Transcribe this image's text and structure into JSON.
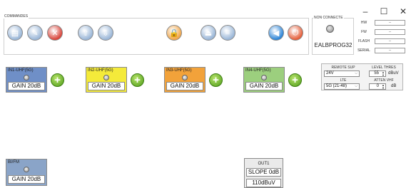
{
  "window": {
    "minimize_glyph": "–",
    "maximize_glyph": "☐",
    "close_glyph": "✕"
  },
  "commandes": {
    "label": "COMMANDES",
    "buttons": [
      {
        "name": "open-file-icon",
        "glyph": "▤",
        "color": "#9bb7d8"
      },
      {
        "name": "edit-icon",
        "glyph": "✎",
        "color": "#9bb7d8"
      },
      {
        "name": "cancel-icon",
        "glyph": "✕",
        "color": "#d9453b"
      },
      {
        "name": "upload-icon",
        "glyph": "⇧",
        "color": "#9bb7d8"
      },
      {
        "name": "download-icon",
        "glyph": "⇩",
        "color": "#9bb7d8"
      },
      {
        "name": "lock-icon",
        "glyph": "🔒",
        "color": "#f0a64a"
      },
      {
        "name": "eject-icon",
        "glyph": "⏏",
        "color": "#9bb7d8"
      },
      {
        "name": "list-icon",
        "glyph": "≡",
        "color": "#9bb7d8"
      },
      {
        "name": "back-arrow-icon",
        "glyph": "◀",
        "color": "#2e86d8"
      },
      {
        "name": "power-icon",
        "glyph": "⏻",
        "color": "#e5603c"
      }
    ]
  },
  "connection": {
    "title": "NON CONNECTE",
    "device_name": "EALBPROG32"
  },
  "info": [
    {
      "label": "HW",
      "value": "--"
    },
    {
      "label": "FW",
      "value": "--"
    },
    {
      "label": "FLASH",
      "value": "--"
    },
    {
      "label": "SERIAL",
      "value": "--"
    }
  ],
  "inputs": [
    {
      "title": "IN1-UHF(5G)",
      "gain": "GAIN 20dB",
      "color": "#6f8fc7"
    },
    {
      "title": "IN2-UHF(5G)",
      "gain": "GAIN 20dB",
      "color": "#f4ea3a"
    },
    {
      "title": "IN3-UHF(5G)",
      "gain": "GAIN 20dB",
      "color": "#f2a23a"
    },
    {
      "title": "IN4-UHF(5G)",
      "gain": "GAIN 20dB",
      "color": "#9ccf7e"
    }
  ],
  "bifm": {
    "title": "BI/FM",
    "gain": "GAIN 20dB",
    "color": "#8aa4c8"
  },
  "settings": {
    "remote_sup_label": "REMOTE SUP",
    "remote_sup_value": "24V",
    "lte_label": "LTE",
    "lte_value": "5G (21-48)",
    "level_thres_label": "LEVEL THRES",
    "level_thres_value": "55",
    "level_thres_unit": "dBuV",
    "atten_vhf_label": "ATTEN VHF",
    "atten_vhf_value": "0",
    "atten_vhf_unit": "dB"
  },
  "output": {
    "title": "OUT1",
    "slope": "SLOPE 0dB",
    "level": "110dBuV"
  }
}
